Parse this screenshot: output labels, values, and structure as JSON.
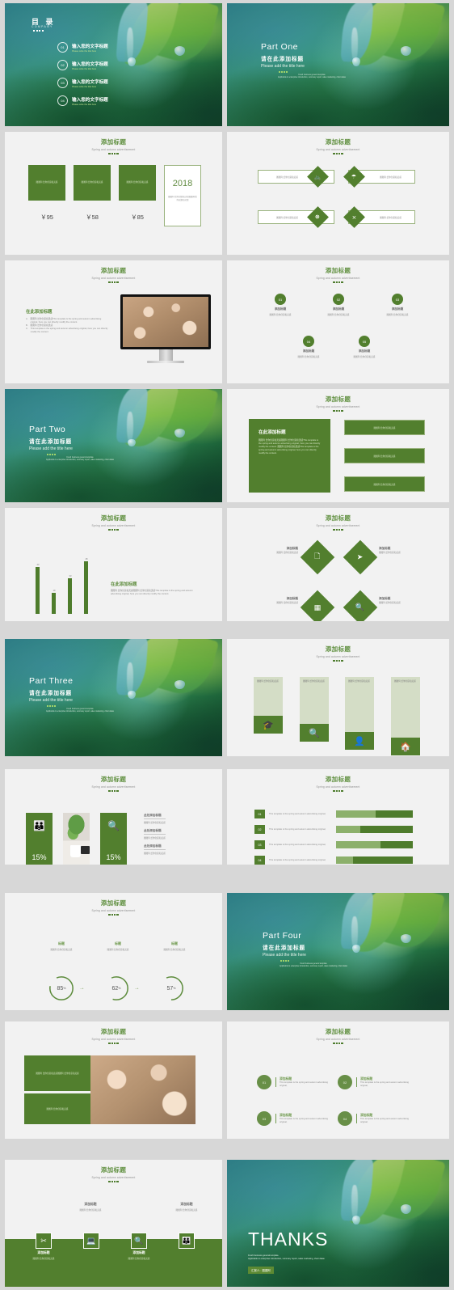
{
  "theme": {
    "green": "#527f2e",
    "green_light": "#8cb06b",
    "title_green": "#5f8f3e",
    "bg": "#f2f2f2"
  },
  "common": {
    "title": "添加标题",
    "subtitle": "Spring and autumn advertisement",
    "ph_short": "图图阿  给你创意和灵感",
    "body_en": "This template is the spring and autumn advertising original, here you can directly modify the content."
  },
  "slides": [
    {
      "id": "catalog",
      "title": "目 录",
      "company": "COMPANY",
      "items": [
        {
          "num": "01",
          "cn": "输入您的文字标题",
          "en": "Please write the title here"
        },
        {
          "num": "02",
          "cn": "输入您的文字标题",
          "en": "Please write the title here"
        },
        {
          "num": "03",
          "cn": "输入您的文字标题",
          "en": "Please write the title here"
        },
        {
          "num": "04",
          "cn": "输入您的文字标题",
          "en": "Please write the title here"
        }
      ]
    },
    {
      "id": "part1",
      "en": "Part One",
      "cn": "请在此添加标题",
      "sub": "Please add the title here",
      "note": "Fresh business general template\nApplicable to enterprise introduction, summary report, sales marketing, chart datas"
    },
    {
      "id": "price",
      "cards": [
        {
          "ph": "图图阿  给你创意和灵感",
          "price": "￥95"
        },
        {
          "ph": "图图阿  给你创意和灵感",
          "price": "￥58"
        },
        {
          "ph": "图图阿  给你创意和灵感",
          "price": "￥85"
        }
      ],
      "year": "2018",
      "year_text": "图图阿   给你创意和灵感图图阿给你创意和灵感"
    },
    {
      "id": "diamonds",
      "items": [
        {
          "icon": "bicycle-icon",
          "glyph": "🚲",
          "ph": "图图阿  给你创意和灵感"
        },
        {
          "icon": "umbrella-icon",
          "glyph": "☂",
          "ph": "图图阿  给你创意和灵感"
        },
        {
          "icon": "lifebuoy-icon",
          "glyph": "◍",
          "ph": "图图阿  给你创意和灵感"
        },
        {
          "icon": "shuffle-icon",
          "glyph": "⤬",
          "ph": "图图阿  给你创意和灵感"
        }
      ]
    },
    {
      "id": "monitor",
      "heading": "在此添加标题",
      "list": [
        {
          "marker": "A.",
          "text": "图图阿  给你创意和灵感This template is the spring and autumn advertising original, here you can directly modify the content."
        },
        {
          "marker": "B.",
          "text": "图图阿  给你创意和灵感"
        },
        {
          "marker": "C.",
          "text": "This template is the spring and autumn advertising original, here you can directly modify the content."
        }
      ]
    },
    {
      "id": "five-circles",
      "items": [
        {
          "num": "01",
          "title": "添加标题",
          "ph": "图图阿  给你创意和灵感"
        },
        {
          "num": "02",
          "title": "添加标题",
          "ph": "图图阿  给你创意和灵感"
        },
        {
          "num": "03",
          "title": "添加标题",
          "ph": "图图阿  给你创意和灵感"
        },
        {
          "num": "04",
          "title": "添加标题",
          "ph": "图图阿  给你创意和灵感"
        },
        {
          "num": "05",
          "title": "添加标题",
          "ph": "图图阿  给你创意和灵感"
        }
      ]
    },
    {
      "id": "part2",
      "en": "Part Two",
      "cn": "请在此添加标题",
      "sub": "Please add the title here"
    },
    {
      "id": "greenblock",
      "heading": "在此添加标题",
      "body": "图图阿   给你创意和灵感图图阿   给你创意和灵感This template is the spring and autumn advertising original, here you can directly modify the content. 图图阿   给你创意和灵感This template is the spring and autumn advertising original, here you can directly modify the content.",
      "bars": [
        "图图阿  给你创意和灵感",
        "图图阿  给你创意和灵感",
        "图图阿  给你创意和灵感"
      ]
    },
    {
      "id": "barchart",
      "heading": "在此添加标题",
      "body": "图图阿   给你创意和灵感图图阿   给你创意和灵感This template is the spring and autumn advertising original, here you can directly modify the content."
    },
    {
      "id": "diamond4",
      "items": [
        {
          "icon": "document-icon",
          "glyph": "🗐",
          "title": "添加标题",
          "ph": "图图阿  给你创意和灵感"
        },
        {
          "icon": "send-icon",
          "glyph": "➤",
          "title": "添加标题",
          "ph": "图图阿  给你创意和灵感"
        },
        {
          "icon": "calendar-icon",
          "glyph": "▤",
          "title": "添加标题",
          "ph": "图图阿  给你创意和灵感"
        },
        {
          "icon": "search-icon",
          "glyph": "🔍",
          "title": "添加标题",
          "ph": "图图阿  给你创意和灵感"
        }
      ]
    },
    {
      "id": "part3",
      "en": "Part Three",
      "cn": "请在此添加标题",
      "sub": "Please add the title here"
    },
    {
      "id": "vcards",
      "items": [
        {
          "icon": "graduation-cap-icon",
          "glyph": "🎓",
          "ph": "图图阿  给你创意和灵感"
        },
        {
          "icon": "search-icon",
          "glyph": "🔍",
          "ph": "图图阿  给你创意和灵感"
        },
        {
          "icon": "user-icon",
          "glyph": "👤",
          "ph": "图图阿  给你创意和灵感"
        },
        {
          "icon": "home-icon",
          "glyph": "🏠",
          "ph": "图图阿  给你创意和灵感"
        }
      ]
    },
    {
      "id": "percent15",
      "items": [
        {
          "icon": "group-icon",
          "glyph": "👪",
          "value": "15%"
        },
        {
          "icon": "search-icon",
          "glyph": "🔍",
          "value": "15%"
        }
      ],
      "texts": [
        {
          "title": "此处添加标题",
          "ph": "图图阿  给你创意和灵感"
        },
        {
          "title": "此处添加标题",
          "ph": "图图阿  给你创意和灵感"
        },
        {
          "title": "此处添加标题",
          "ph": "图图阿  给你创意和灵感"
        }
      ]
    },
    {
      "id": "progress",
      "rows": [
        {
          "num": "01",
          "text": "This template is the spring and autumn advertising original,",
          "pct": 48
        },
        {
          "num": "02",
          "text": "This template is the spring and autumn advertising original,",
          "pct": 68
        },
        {
          "num": "03",
          "text": "This template is the spring and autumn advertising original,",
          "pct": 42
        },
        {
          "num": "04",
          "text": "This template is the spring and autumn advertising original,",
          "pct": 78
        }
      ]
    },
    {
      "id": "donuts",
      "items": [
        {
          "label": "标题",
          "ph": "图图阿  给你创意和灵感",
          "value": 85,
          "display": "85",
          "unit": "%"
        },
        {
          "label": "标题",
          "ph": "图图阿  给你创意和灵感",
          "value": 62,
          "display": "62",
          "unit": "%"
        },
        {
          "label": "标题",
          "ph": "图图阿  给你创意和灵感",
          "value": 57,
          "display": "57",
          "unit": "%"
        }
      ]
    },
    {
      "id": "part4",
      "en": "Part Four",
      "cn": "请在此添加标题",
      "sub": "Please add the title here"
    },
    {
      "id": "photoblocks",
      "title": "添加标题",
      "ph_left": "图图阿  给你创意和灵感图图阿  给你创意和灵感",
      "ph_bottom": "图图阿  给你创意和灵感"
    },
    {
      "id": "four-circles",
      "items": [
        {
          "num": "01",
          "title": "添加标题",
          "text": "This template is the spring and autumn advertising original,"
        },
        {
          "num": "02",
          "title": "添加标题",
          "text": "This template is the spring and autumn advertising original,"
        },
        {
          "num": "03",
          "title": "添加标题",
          "text": "This template is the spring and autumn advertising original,"
        },
        {
          "num": "04",
          "title": "添加标题",
          "text": "This template is the spring and autumn advertising original,"
        }
      ]
    },
    {
      "id": "timeline",
      "items": [
        {
          "icon": "scissors-icon",
          "glyph": "✂",
          "title": "添加标题",
          "ph": "图图阿  给你创意和灵感",
          "pos": "below"
        },
        {
          "icon": "laptop-icon",
          "glyph": "💻",
          "title": "添加标题",
          "ph": "图图阿  给你创意和灵感",
          "pos": "above"
        },
        {
          "icon": "search-icon",
          "glyph": "🔍",
          "title": "添加标题",
          "ph": "图图阿  给你创意和灵感",
          "pos": "below"
        },
        {
          "icon": "group-icon",
          "glyph": "👪",
          "title": "添加标题",
          "ph": "图图阿  给你创意和灵感",
          "pos": "above"
        }
      ]
    },
    {
      "id": "thanks",
      "title": "THANKS",
      "note": "Fresh business general template.\nApplicable to enterprise introduction, summary report, sales marketing, chart datas",
      "tag": "汇报人：图图阿"
    }
  ],
  "chart_data": {
    "type": "bar",
    "title": "添加标题",
    "categories": [
      "1",
      "2",
      "3",
      "4"
    ],
    "values": [
      43,
      19,
      33,
      48
    ],
    "labels": [
      "43",
      "19",
      "33",
      "48"
    ],
    "ylim": [
      0,
      55
    ],
    "xlabel": "",
    "ylabel": "",
    "grid": false,
    "legend": "none"
  }
}
